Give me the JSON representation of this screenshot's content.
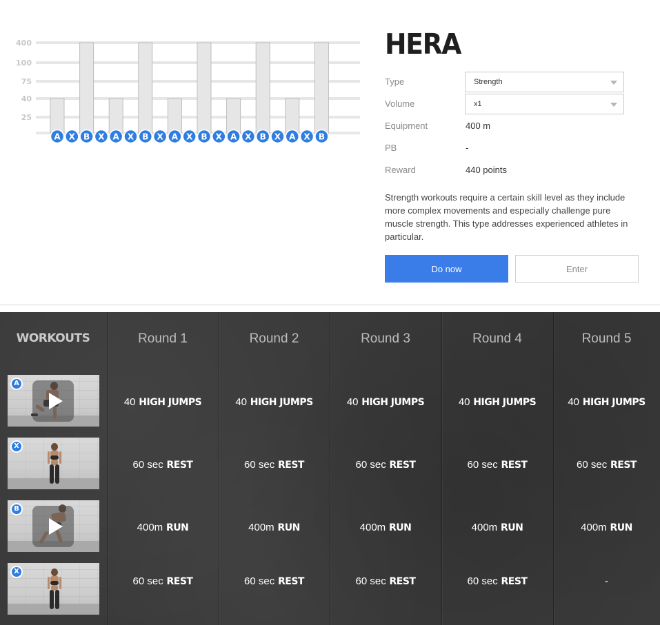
{
  "workout": {
    "title": "HERA",
    "info": [
      {
        "label": "Type",
        "value": "Strength",
        "kind": "select"
      },
      {
        "label": "Volume",
        "value": "x1",
        "kind": "select"
      },
      {
        "label": "Equipment",
        "value": "400 m",
        "kind": "text"
      },
      {
        "label": "PB",
        "value": "-",
        "kind": "text"
      },
      {
        "label": "Reward",
        "value": "440 points",
        "kind": "text"
      }
    ],
    "description": "Strength workouts require a certain skill level as they include more complex movements and especially challenge pure muscle strength. This type addresses experienced athletes in particular.",
    "primary_button": "Do now",
    "secondary_button": "Enter"
  },
  "chart_data": {
    "type": "bar",
    "scale": "categorical",
    "ticks": [
      "400",
      "100",
      "75",
      "40",
      "25"
    ],
    "categories": [
      "A",
      "X",
      "B",
      "X",
      "A",
      "X",
      "B",
      "X",
      "A",
      "X",
      "B",
      "X",
      "A",
      "X",
      "B",
      "X",
      "A",
      "X",
      "B"
    ],
    "values": [
      "40",
      "",
      "400",
      "",
      "40",
      "",
      "400",
      "",
      "40",
      "",
      "400",
      "",
      "40",
      "",
      "400",
      "",
      "40",
      "",
      "400"
    ],
    "accent_color": "#2f7de1",
    "bar_color": "#e6e6e6"
  },
  "table": {
    "workouts_header": "WORKOUTS",
    "rounds": [
      "Round 1",
      "Round 2",
      "Round 3",
      "Round 4",
      "Round 5"
    ],
    "exercises": [
      {
        "letter": "A",
        "video": true,
        "figure": "jump"
      },
      {
        "letter": "X",
        "video": false,
        "figure": "stand"
      },
      {
        "letter": "B",
        "video": true,
        "figure": "run"
      },
      {
        "letter": "X",
        "video": false,
        "figure": "stand"
      }
    ],
    "rows": [
      [
        {
          "qty": "40",
          "act": "HIGH JUMPS"
        },
        {
          "qty": "40",
          "act": "HIGH JUMPS"
        },
        {
          "qty": "40",
          "act": "HIGH JUMPS"
        },
        {
          "qty": "40",
          "act": "HIGH JUMPS"
        },
        {
          "qty": "40",
          "act": "HIGH JUMPS"
        }
      ],
      [
        {
          "qty": "60 sec",
          "act": "REST"
        },
        {
          "qty": "60 sec",
          "act": "REST"
        },
        {
          "qty": "60 sec",
          "act": "REST"
        },
        {
          "qty": "60 sec",
          "act": "REST"
        },
        {
          "qty": "60 sec",
          "act": "REST"
        }
      ],
      [
        {
          "qty": "400m",
          "act": "RUN"
        },
        {
          "qty": "400m",
          "act": "RUN"
        },
        {
          "qty": "400m",
          "act": "RUN"
        },
        {
          "qty": "400m",
          "act": "RUN"
        },
        {
          "qty": "400m",
          "act": "RUN"
        }
      ],
      [
        {
          "qty": "60 sec",
          "act": "REST"
        },
        {
          "qty": "60 sec",
          "act": "REST"
        },
        {
          "qty": "60 sec",
          "act": "REST"
        },
        {
          "qty": "60 sec",
          "act": "REST"
        },
        {
          "qty": "-",
          "act": ""
        }
      ]
    ]
  }
}
